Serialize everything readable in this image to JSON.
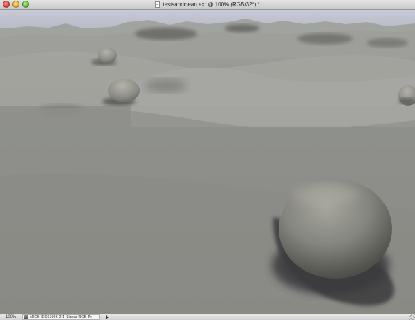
{
  "window": {
    "title": "testsandclean.exr @ 100% (RGB/32*) *"
  },
  "statusbar": {
    "zoom": "100%",
    "doc_info": "sRGB IEC61966-2.1 (Linear RGB Pro..."
  },
  "image": {
    "subject": "rendered sand dunes with stone spheres",
    "colors": {
      "sky": "#c3c8d5",
      "sand_light": "#9d9d97",
      "sand_dark": "#5b5b57",
      "shadow": "#3c3c3f"
    }
  },
  "icons": [
    "document-icon",
    "info-icon",
    "popup-arrow-icon",
    "resize-handle-icon"
  ]
}
